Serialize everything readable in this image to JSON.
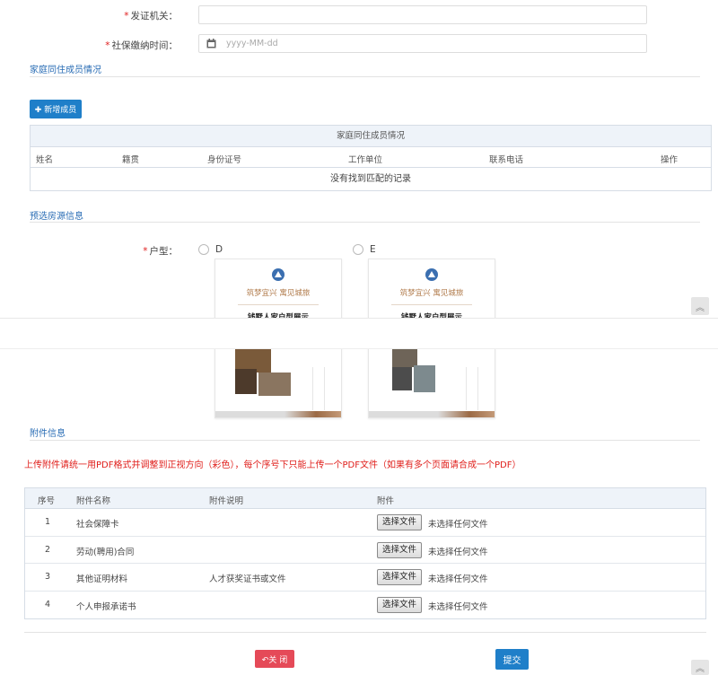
{
  "form": {
    "issuer": {
      "required_mark": "*",
      "label": "发证机关：",
      "value": ""
    },
    "social_time": {
      "required_mark": "*",
      "label": "社保缴纳时间：",
      "placeholder": "yyyy-MM-dd",
      "icon": "calendar-icon"
    }
  },
  "family": {
    "section_title": "家庭同住成员情况",
    "add_button": "✚ 新增成员",
    "table": {
      "caption": "家庭同住成员情况",
      "columns": [
        "姓名",
        "籍贯",
        "身份证号",
        "工作单位",
        "联系电话",
        "操作"
      ],
      "empty_text": "没有找到匹配的记录"
    }
  },
  "housing": {
    "section_title": "预选房源信息",
    "type_label": "户型：",
    "required_mark": "*",
    "options": [
      {
        "label": "D",
        "slogan": "筑梦宜兴  寓见城旅",
        "title": "钱墅人家户型展示"
      },
      {
        "label": "E",
        "slogan": "筑梦宜兴  寓见城旅",
        "title": "钱墅人家户型展示"
      }
    ]
  },
  "attachments": {
    "section_title": "附件信息",
    "warning": "上传附件请统一用PDF格式并调整到正视方向（彩色），每个序号下只能上传一个PDF文件（如果有多个页面请合成一个PDF）",
    "columns": [
      "序号",
      "附件名称",
      "附件说明",
      "附件"
    ],
    "rows": [
      {
        "no": "1",
        "name": "社会保障卡",
        "desc": "",
        "button": "选择文件",
        "status": "未选择任何文件"
      },
      {
        "no": "2",
        "name": "劳动(聘用)合同",
        "desc": "",
        "button": "选择文件",
        "status": "未选择任何文件"
      },
      {
        "no": "3",
        "name": "其他证明材料",
        "desc": "人才获奖证书或文件",
        "button": "选择文件",
        "status": "未选择任何文件"
      },
      {
        "no": "4",
        "name": "个人申报承诺书",
        "desc": "",
        "button": "选择文件",
        "status": "未选择任何文件"
      }
    ]
  },
  "actions": {
    "close": "↶关 闭",
    "submit": "提交"
  },
  "scroll_top_glyph": "︽",
  "colors": {
    "accent": "#1f7fc9",
    "danger": "#e54a58",
    "warning_text": "#e0201c",
    "section_title": "#2a6db5"
  }
}
